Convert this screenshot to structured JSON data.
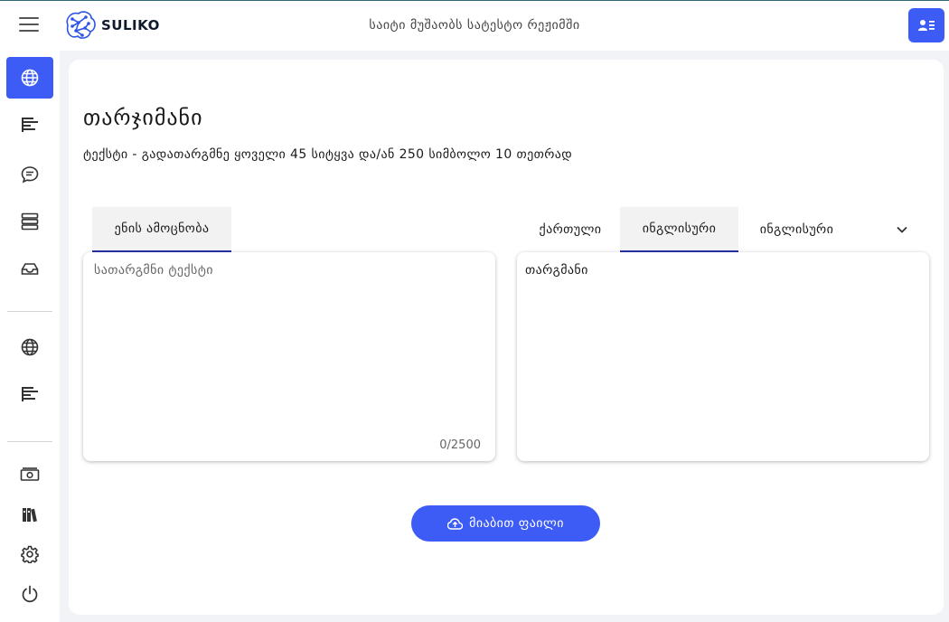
{
  "header": {
    "logo_text": "SULIKO",
    "status_text": "საიტი მუშაობს სატესტო რეჟიმში"
  },
  "sidebar": {
    "items": [
      {
        "icon": "globe-icon",
        "active": true
      },
      {
        "icon": "text-align-icon"
      },
      {
        "icon": "chat-bubble-icon"
      },
      {
        "icon": "server-list-icon"
      },
      {
        "icon": "inbox-icon"
      },
      {
        "icon": "globe-icon"
      },
      {
        "icon": "text-align-icon"
      },
      {
        "icon": "money-icon"
      },
      {
        "icon": "books-icon"
      },
      {
        "icon": "gear-icon"
      },
      {
        "icon": "power-icon"
      }
    ]
  },
  "main": {
    "title": "თარჯიმანი",
    "subtitle": "ტექსტი - გადათარგმნე ყოველი 45 სიტყვა და/ან 250 სიმბოლო 10 თეთრად",
    "source": {
      "tab_label": "ენის ამოცნობა",
      "placeholder": "სათარგმნი ტექსტი",
      "counter": "0/2500"
    },
    "target": {
      "tabs": [
        "ქართული",
        "ინგლისური",
        "ინგლისური"
      ],
      "active_tab": 1,
      "output": "თარგმანი"
    },
    "upload_label": "მიაბით ფაილი"
  },
  "colors": {
    "accent": "#3d5cf5",
    "tab_underline": "#2432a8",
    "background": "#f1f3f6"
  }
}
